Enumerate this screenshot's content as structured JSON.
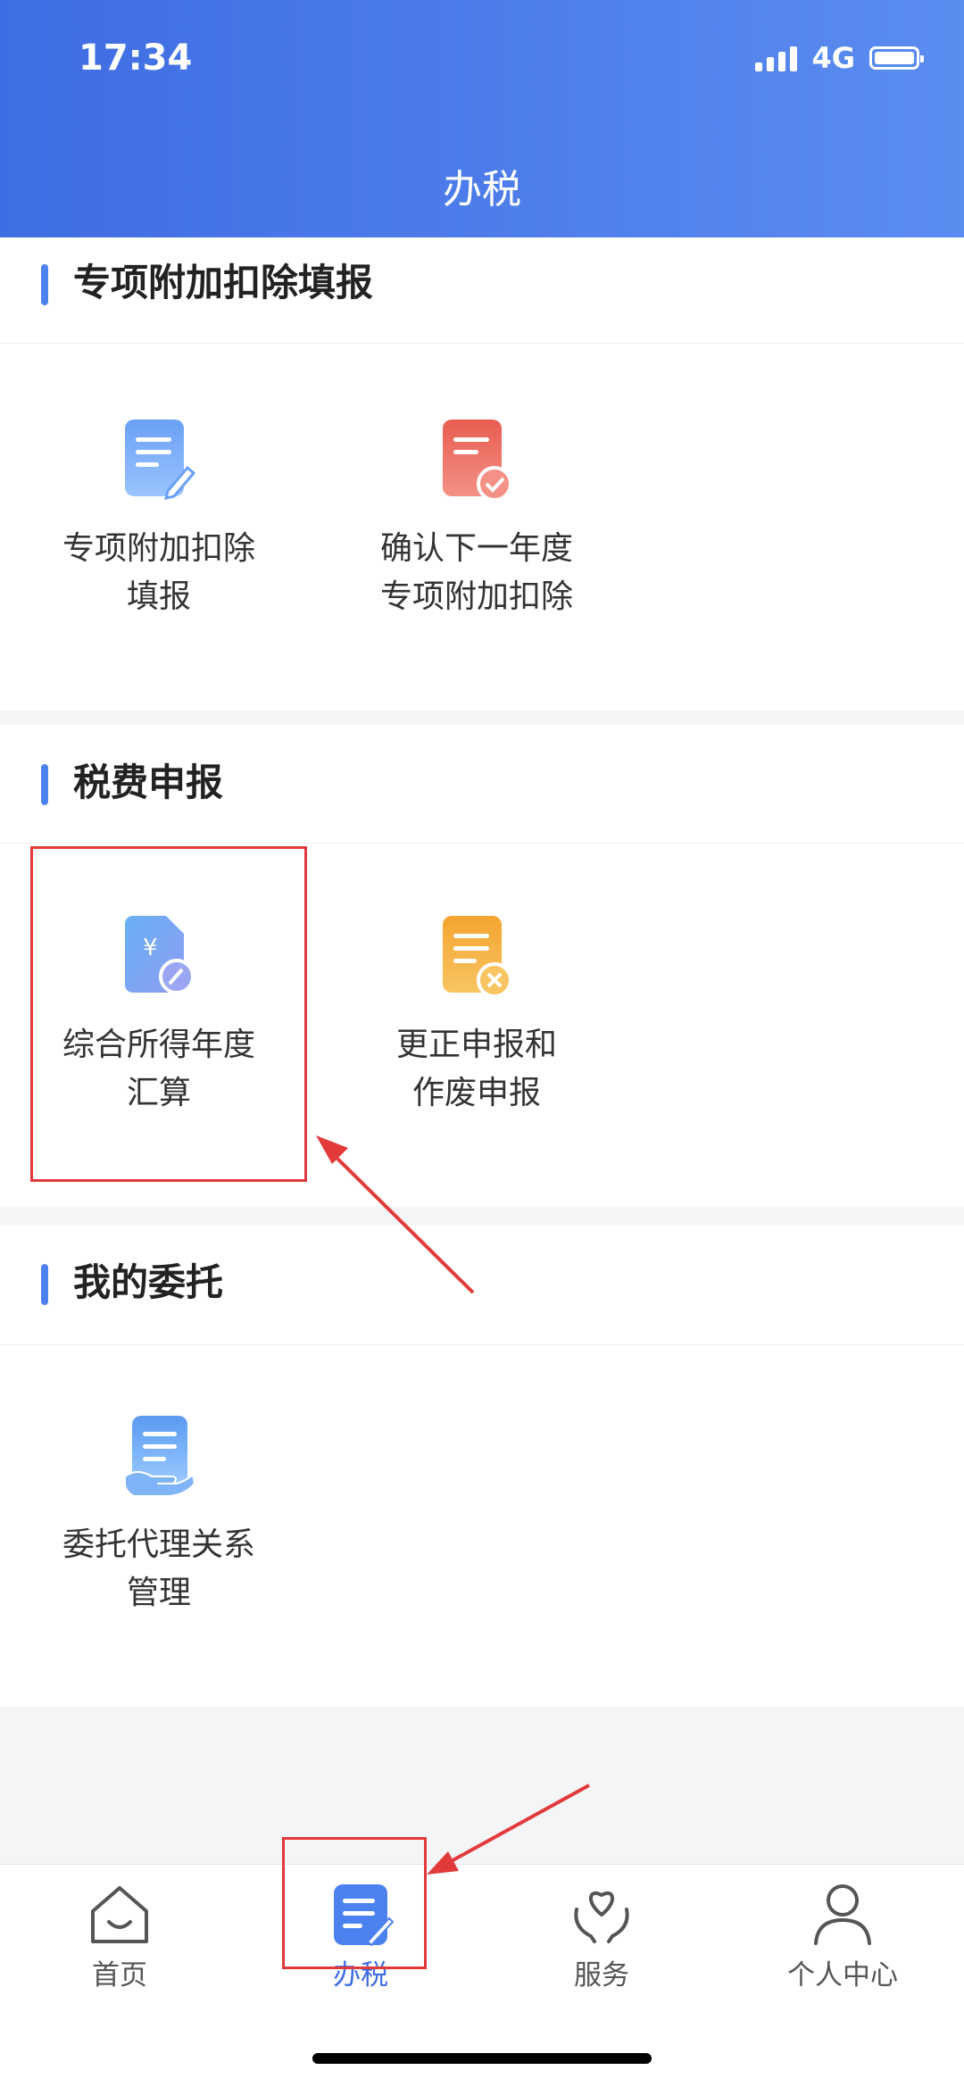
{
  "status_bar": {
    "time": "17:34",
    "network": "4G"
  },
  "header": {
    "title": "办税"
  },
  "sections": [
    {
      "title": "专项附加扣除填报",
      "items": [
        {
          "label": "专项附加扣除\n填报",
          "icon": "edit-document-icon"
        },
        {
          "label": "确认下一年度\n专项附加扣除",
          "icon": "check-document-icon"
        }
      ]
    },
    {
      "title": "税费申报",
      "items": [
        {
          "label": "综合所得年度\n汇算",
          "icon": "yuan-document-icon"
        },
        {
          "label": "更正申报和\n作废申报",
          "icon": "cancel-document-icon"
        }
      ]
    },
    {
      "title": "我的委托",
      "items": [
        {
          "label": "委托代理关系\n管理",
          "icon": "hand-document-icon"
        }
      ]
    }
  ],
  "tabbar": {
    "tabs": [
      {
        "label": "首页",
        "icon": "home-icon"
      },
      {
        "label": "办税",
        "icon": "tax-document-icon"
      },
      {
        "label": "服务",
        "icon": "heart-hands-icon"
      },
      {
        "label": "个人中心",
        "icon": "person-icon"
      }
    ],
    "active": "办税"
  },
  "colors": {
    "header_start": "#3f6de3",
    "header_end": "#5b8cf0",
    "accent": "#4c82f0",
    "annotation": "#e23a3a"
  }
}
